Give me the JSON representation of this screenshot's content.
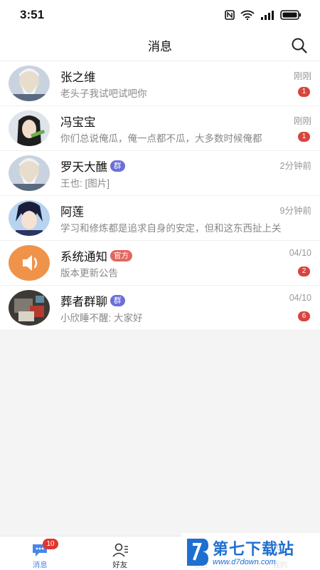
{
  "status_bar": {
    "time": "3:51"
  },
  "header": {
    "title": "消息"
  },
  "conversations": [
    {
      "name": "张之维",
      "tag": "",
      "preview": "老头子我试吧试吧你",
      "time": "刚刚",
      "badge": "1"
    },
    {
      "name": "冯宝宝",
      "tag": "",
      "preview": "你们总说俺瓜，俺一点都不瓜，大多数时候俺都",
      "time": "刚刚",
      "badge": "1"
    },
    {
      "name": "罗天大醮",
      "tag": "群",
      "preview": "王也: [图片]",
      "time": "2分钟前",
      "badge": ""
    },
    {
      "name": "阿莲",
      "tag": "",
      "preview": "学习和修炼都是追求自身的安定，但和这东西扯上关",
      "time": "9分钟前",
      "badge": ""
    },
    {
      "name": "系统通知",
      "tag": "官方",
      "preview": "版本更新公告",
      "time": "04/10",
      "badge": "2"
    },
    {
      "name": "葬者群聊",
      "tag": "群",
      "preview": "小欣睡不醒: 大家好",
      "time": "04/10",
      "badge": "6"
    }
  ],
  "tabbar": {
    "tabs": [
      {
        "label": "消息",
        "icon": "chat-icon",
        "badge": "10"
      },
      {
        "label": "好友",
        "icon": "friends-icon"
      },
      {
        "label": "动态",
        "icon": "moments-icon"
      },
      {
        "label": "我的",
        "icon": "profile-icon"
      }
    ]
  },
  "watermark": {
    "cn": "第七下载站",
    "url": "www.d7down.com"
  },
  "colors": {
    "accent": "#4a86e8",
    "badge": "#d9443e",
    "group_tag": "#6a6fd8",
    "official_tag": "#e2675e"
  }
}
